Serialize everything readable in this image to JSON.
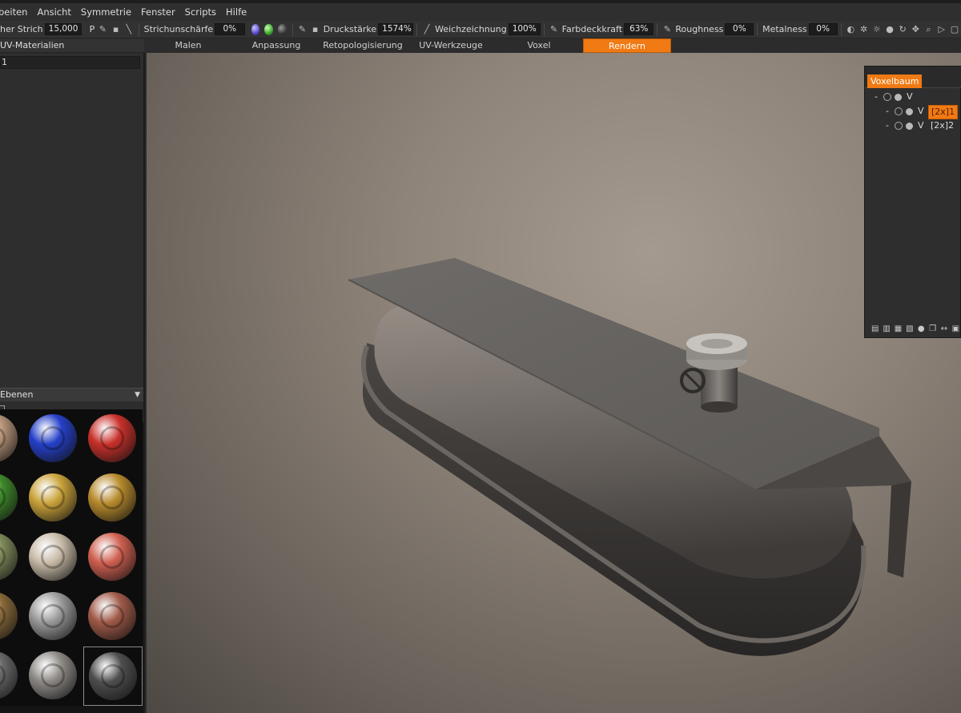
{
  "menu": {
    "items": [
      "beiten",
      "Ansicht",
      "Symmetrie",
      "Fenster",
      "Scripts",
      "Hilfe"
    ]
  },
  "toolbar": {
    "strich_label": "her Strich",
    "strich_value": "15,000",
    "p_label": "P",
    "strichunschaerfe_label": "Strichunschärfe",
    "strichunschaerfe_value": "0%",
    "druckstaerke_label": "Druckstärke",
    "druckstaerke_value": "1574%",
    "weichzeichnung_label": "Weichzeichnung",
    "weichzeichnung_value": "100%",
    "farbdeckkraft_label": "Farbdeckkraft",
    "farbdeckkraft_value": "63%",
    "roughness_label": "Roughness",
    "roughness_value": "0%",
    "metalness_label": "Metalness",
    "metalness_value": "0%"
  },
  "tabs": {
    "uv_materialien": "UV-Materialien",
    "malen": "Malen",
    "anpassung": "Anpassung",
    "retopo": "Retopologisierung",
    "uv_werkzeuge": "UV-Werkzeuge",
    "voxel": "Voxel",
    "rendern": "Rendern",
    "active": "Rendern"
  },
  "left_panel": {
    "uv_row": "1",
    "ebenen_title": "Ebenen"
  },
  "voxel_tree": {
    "title": "Voxelbaum",
    "root": {
      "prefix": "-",
      "label": "V"
    },
    "children": [
      {
        "prefix": "-",
        "label": "V",
        "name": "[2x]1",
        "selected": true
      },
      {
        "prefix": "-",
        "label": "V",
        "name": "[2x]2",
        "selected": false
      }
    ]
  },
  "materials": [
    {
      "color": "#b9967a"
    },
    {
      "color": "#2540c8"
    },
    {
      "color": "#c8302a"
    },
    {
      "color": "#3f8a2a"
    },
    {
      "color": "#c9a23a"
    },
    {
      "color": "#b78a2c"
    },
    {
      "color": "#7f8a5a"
    },
    {
      "color": "#c9bca8"
    },
    {
      "color": "#d06050"
    },
    {
      "color": "#8a6a3a"
    },
    {
      "color": "#9a9a9a"
    },
    {
      "color": "#a05a48"
    },
    {
      "color": "#6a6a6a"
    },
    {
      "color": "#8e8a86"
    },
    {
      "color": "#4e4e4e"
    }
  ],
  "colors": {
    "accent": "#f07a13"
  }
}
